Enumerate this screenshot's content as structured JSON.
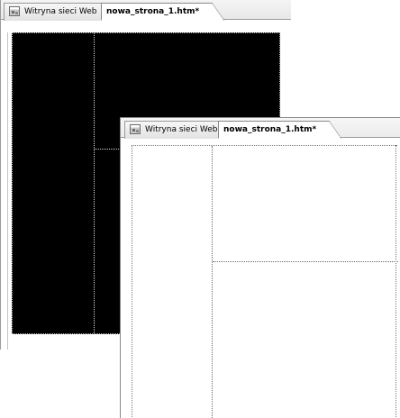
{
  "back_window": {
    "tabs": [
      {
        "label": "Witryna sieci Web",
        "icon": "website-icon",
        "active": false
      },
      {
        "label": "nowa_strona_1.htm*",
        "active": true
      }
    ],
    "page_background": "#000000"
  },
  "front_window": {
    "tabs": [
      {
        "label": "Witryna sieci Web",
        "icon": "website-icon",
        "active": false
      },
      {
        "label": "nowa_strona_1.htm*",
        "active": true
      }
    ],
    "page_background": "#ffffff"
  }
}
